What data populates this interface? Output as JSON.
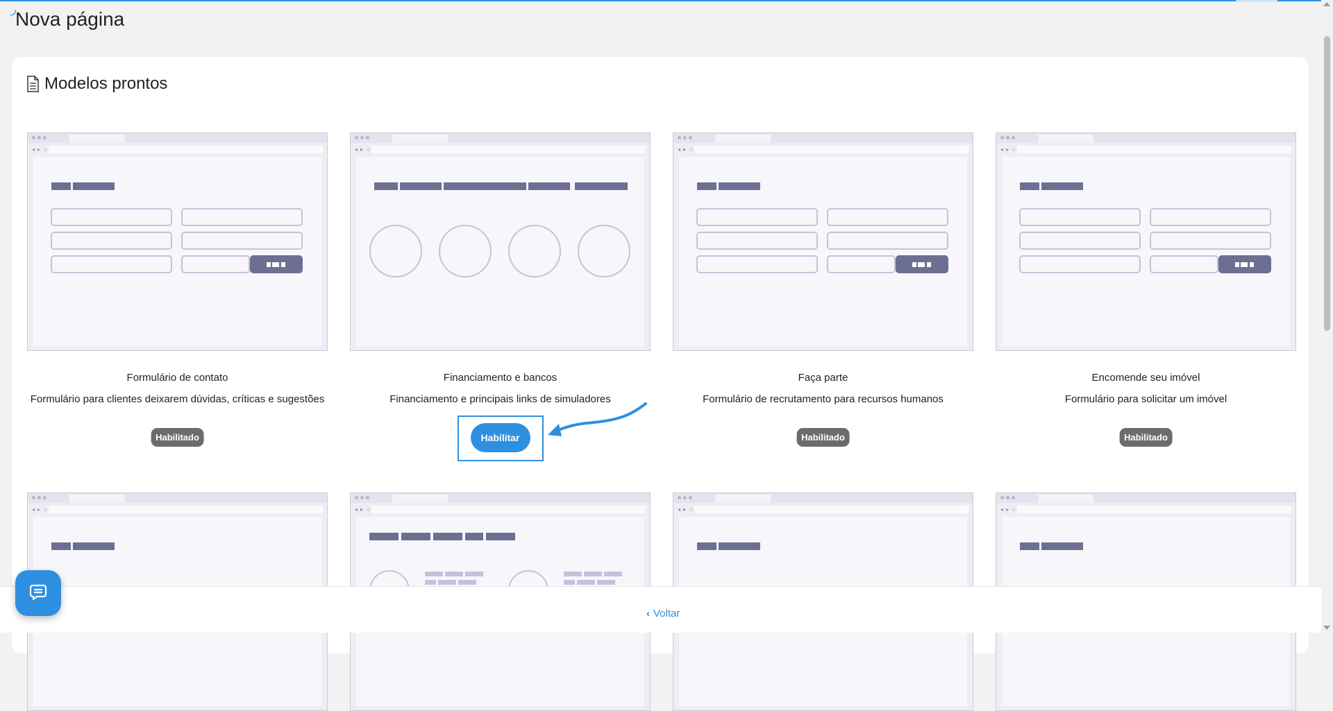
{
  "page": {
    "title": "Nova página"
  },
  "section": {
    "title": "Modelos prontos",
    "icon": "document-icon"
  },
  "templates_row1": [
    {
      "name": "Formulário de contato",
      "description": "Formulário para clientes deixarem dúvidas, críticas e sugestões",
      "status": "Habilitado",
      "preview": "form"
    },
    {
      "name": "Financiamento e bancos",
      "description": "Financiamento e principais links de simuladores",
      "status": "Habilitar",
      "preview": "banks"
    },
    {
      "name": "Faça parte",
      "description": "Formulário de recrutamento para recursos humanos",
      "status": "Habilitado",
      "preview": "form"
    },
    {
      "name": "Encomende seu imóvel",
      "description": "Formulário para solicitar um imóvel",
      "status": "Habilitado",
      "preview": "form"
    }
  ],
  "templates_row2_previews": [
    "form",
    "team",
    "form",
    "form"
  ],
  "annotation": {
    "arrow_color": "#2e8fe0",
    "highlight_color": "#2e8fe0"
  },
  "footer": {
    "back_label": "Voltar",
    "back_icon": "chevron-left-icon"
  },
  "chat": {
    "icon": "chat-icon"
  },
  "colors": {
    "accent": "#2e8fe0",
    "badge": "#6c6c6c",
    "mock_bar": "#6c6e92",
    "mock_outline": "#c7c1da"
  }
}
